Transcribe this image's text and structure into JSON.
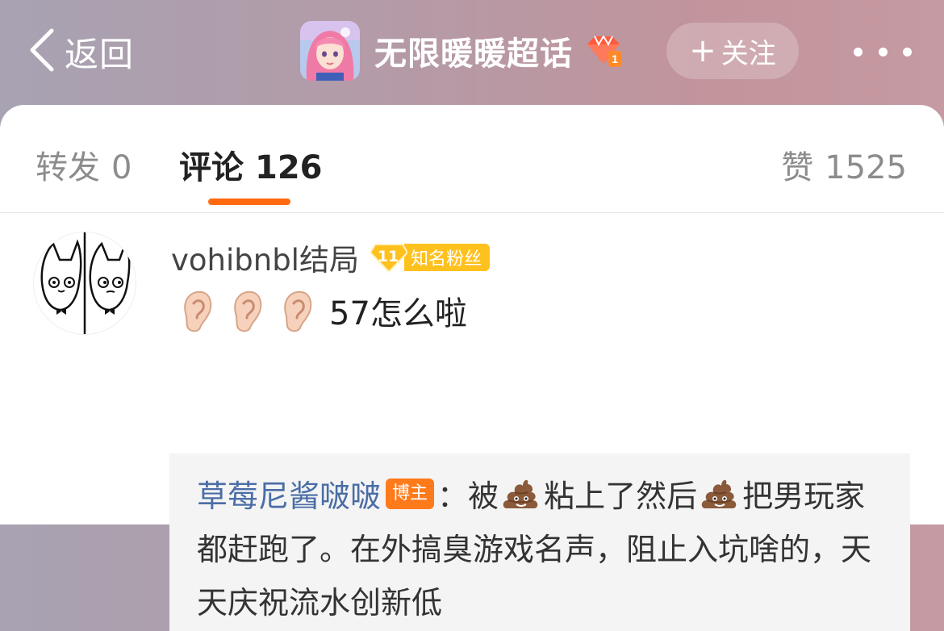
{
  "nav": {
    "back_label": "返回",
    "topic_title": "无限暖暖超话",
    "topic_level": "1",
    "follow_label": "关注",
    "colors": {
      "diamond": "#ff5a3c",
      "text": "#ffffff"
    }
  },
  "tabs": {
    "repost": {
      "label": "转发",
      "count": "0"
    },
    "comment": {
      "label": "评论",
      "count": "126"
    },
    "like": {
      "label": "赞",
      "count": "1525"
    },
    "accent": "#ff6a10"
  },
  "comment": {
    "username": "vohibnbl结局",
    "fan_level": "11",
    "fan_badge": "知名粉丝",
    "emojis": [
      "ear",
      "ear",
      "ear"
    ],
    "text": "57怎么啦"
  },
  "reply": {
    "username": "草莓尼酱啵啵",
    "badge": "博主",
    "separator": "：",
    "seg1": "被",
    "seg2": "粘上了然后",
    "seg3": "把男玩家都赶跑了。在外搞臭游戏名声，阻止入坑啥的，天天庆祝流水创新低",
    "emoji": "poop"
  }
}
